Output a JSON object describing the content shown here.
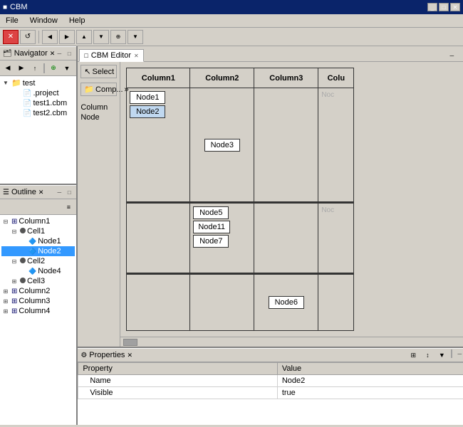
{
  "window": {
    "title": "CBM",
    "title_icon": "■"
  },
  "menu": {
    "items": [
      "File",
      "Window",
      "Help"
    ]
  },
  "toolbar": {
    "buttons": [
      "✕",
      "↺",
      "|",
      "←",
      "→",
      "↑",
      "↓",
      "⊕",
      "▼"
    ]
  },
  "navigator": {
    "title": "Navigator",
    "toolbar_buttons": [
      "◀",
      "▶",
      "↑",
      "⊕",
      "▼"
    ],
    "tree": [
      {
        "level": 0,
        "label": "test",
        "type": "folder",
        "expanded": true
      },
      {
        "level": 1,
        "label": ".project",
        "type": "file"
      },
      {
        "level": 1,
        "label": "test1.cbm",
        "type": "cbm"
      },
      {
        "level": 1,
        "label": "test2.cbm",
        "type": "cbm"
      }
    ]
  },
  "outline": {
    "title": "Outline",
    "tree": [
      {
        "level": 0,
        "label": "Column1",
        "type": "grid",
        "expanded": true
      },
      {
        "level": 1,
        "label": "Cell1",
        "type": "dot",
        "expanded": true
      },
      {
        "level": 2,
        "label": "Node1",
        "type": "node"
      },
      {
        "level": 2,
        "label": "Node2",
        "type": "node",
        "selected": true
      },
      {
        "level": 1,
        "label": "Cell2",
        "type": "dot",
        "expanded": true
      },
      {
        "level": 2,
        "label": "Node4",
        "type": "node"
      },
      {
        "level": 1,
        "label": "Cell3",
        "type": "dot"
      },
      {
        "level": 0,
        "label": "Column2",
        "type": "grid"
      },
      {
        "level": 0,
        "label": "Column3",
        "type": "grid"
      },
      {
        "level": 0,
        "label": "Column4",
        "type": "grid"
      }
    ]
  },
  "editor": {
    "tab_label": "CBM Editor",
    "toolbar": {
      "select_label": "Select",
      "comp_label": "Comp...",
      "column_label": "Column",
      "node_label": "Node"
    },
    "columns": [
      {
        "header": "Column1",
        "cells": [
          {
            "nodes": [
              "Node1",
              "Node2"
            ],
            "selected_node": "Node2"
          }
        ]
      },
      {
        "header": "Column2",
        "cells": [
          {
            "nodes": [
              "Node3"
            ]
          },
          {
            "nodes": [
              "Node5",
              "Node11",
              "Node7"
            ]
          }
        ]
      },
      {
        "header": "Column3",
        "cells": [
          {
            "nodes": []
          },
          {
            "nodes": []
          },
          {
            "nodes": [
              "Node6"
            ]
          }
        ]
      },
      {
        "header": "Colu",
        "cells": [
          {
            "nodes": [
              "Noc"
            ]
          },
          {
            "nodes": [
              "Noc"
            ]
          },
          {
            "nodes": []
          }
        ]
      }
    ]
  },
  "properties": {
    "title": "Properties",
    "columns": [
      "Property",
      "Value"
    ],
    "rows": [
      {
        "property": "Name",
        "value": "Node2"
      },
      {
        "property": "Visible",
        "value": "true"
      }
    ]
  },
  "colors": {
    "title_bar": "#0a246a",
    "selected_blue": "#3399ff",
    "node_selected": "#c0d8f0",
    "panel_bg": "#d4d0c8",
    "border": "#808080"
  }
}
